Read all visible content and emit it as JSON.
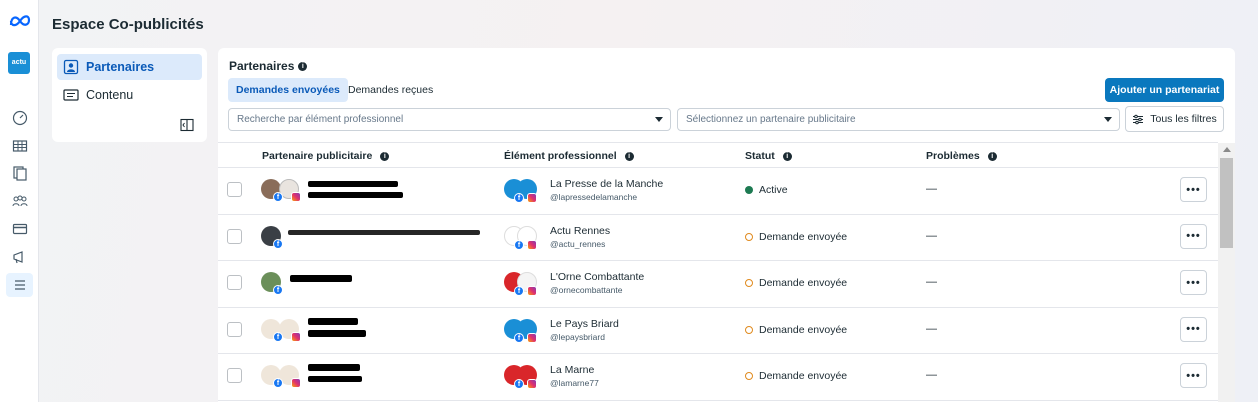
{
  "app": {
    "title": "Espace Co-publicités",
    "logo_icon": "meta-logo-icon",
    "account_avatar": "actu"
  },
  "rail": {
    "items": [
      {
        "icon": "dashboard-icon"
      },
      {
        "icon": "table-icon"
      },
      {
        "icon": "pages-icon"
      },
      {
        "icon": "people-icon"
      },
      {
        "icon": "billing-icon"
      },
      {
        "icon": "megaphone-icon"
      },
      {
        "icon": "menu-icon",
        "active": true
      }
    ]
  },
  "subnav": {
    "items": [
      {
        "label": "Partenaires",
        "icon": "partners-icon",
        "active": true
      },
      {
        "label": "Contenu",
        "icon": "content-icon",
        "active": false
      }
    ]
  },
  "panel": {
    "title": "Partenaires",
    "tabs": [
      {
        "label": "Demandes envoyées",
        "active": true
      },
      {
        "label": "Demandes reçues",
        "active": false
      }
    ],
    "add_button": "Ajouter un partenariat",
    "search": {
      "placeholder": "Recherche par élément professionnel"
    },
    "partner_select": {
      "placeholder": "Sélectionnez un partenaire publicitaire"
    },
    "filters_button": "Tous les filtres"
  },
  "table": {
    "columns": [
      "Partenaire publicitaire",
      "Élément professionnel",
      "Statut",
      "Problèmes"
    ],
    "rows": [
      {
        "asset_name": "La Presse de la Manche",
        "asset_handle": "@lapressedelamanche",
        "status": "Active",
        "status_type": "active",
        "problems": "—",
        "asset_color": "#1a8fd6"
      },
      {
        "asset_name": "Actu Rennes",
        "asset_handle": "@actu_rennes",
        "status": "Demande envoyée",
        "status_type": "pending",
        "problems": "—",
        "asset_color": "#ffffff"
      },
      {
        "asset_name": "L'Orne Combattante",
        "asset_handle": "@ornecombattante",
        "status": "Demande envoyée",
        "status_type": "pending",
        "problems": "—",
        "asset_color": "#d9262a"
      },
      {
        "asset_name": "Le Pays Briard",
        "asset_handle": "@lepaysbriard",
        "status": "Demande envoyée",
        "status_type": "pending",
        "problems": "—",
        "asset_color": "#1a8fd6"
      },
      {
        "asset_name": "La Marne",
        "asset_handle": "@lamarne77",
        "status": "Demande envoyée",
        "status_type": "pending",
        "problems": "—",
        "asset_color": "#d9262a"
      }
    ]
  },
  "colors": {
    "primary": "#0a78be",
    "active_status": "#1d7a52",
    "pending_status": "#e08a1e",
    "selected_bg": "#dceafb"
  }
}
